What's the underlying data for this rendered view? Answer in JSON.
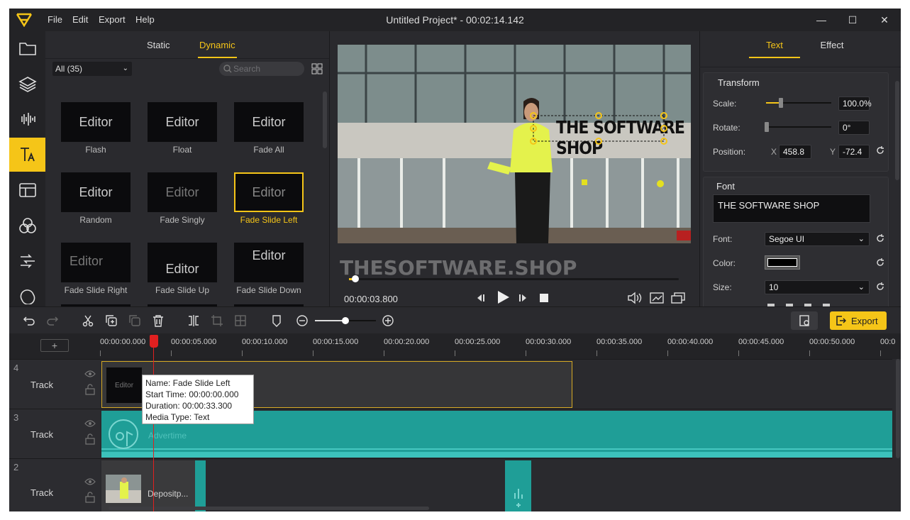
{
  "app": {
    "title": "Untitled Project* - 00:02:14.142"
  },
  "menu": {
    "file": "File",
    "edit": "Edit",
    "export": "Export",
    "help": "Help"
  },
  "library": {
    "tabs": {
      "static": "Static",
      "dynamic": "Dynamic"
    },
    "filter": "All (35)",
    "search_placeholder": "Search",
    "items": [
      {
        "thumb": "Editor",
        "label": "Flash"
      },
      {
        "thumb": "Editor",
        "label": "Float"
      },
      {
        "thumb": "Editor",
        "label": "Fade All"
      },
      {
        "thumb": "Editor",
        "label": "Random"
      },
      {
        "thumb": "Editor",
        "label": "Fade Singly"
      },
      {
        "thumb": "Editor",
        "label": "Fade Slide Left"
      },
      {
        "thumb": "Editor",
        "label": "Fade Slide Right"
      },
      {
        "thumb": "Editor",
        "label": "Fade Slide Up"
      },
      {
        "thumb": "Editor",
        "label": "Fade Slide Down"
      }
    ]
  },
  "preview": {
    "overlay_text": "THE SOFTWARE SHOP",
    "watermark": "THESOFTWARE.SHOP",
    "time": "00:00:03.800",
    "progress": 0.02
  },
  "props": {
    "tabs": {
      "text": "Text",
      "effect": "Effect"
    },
    "transform": {
      "title": "Transform",
      "scale_label": "Scale:",
      "scale_value": "100.0%",
      "rotate_label": "Rotate:",
      "rotate_value": "0°",
      "position_label": "Position:",
      "x_label": "X",
      "x_value": "458.8",
      "y_label": "Y",
      "y_value": "-72.4"
    },
    "font": {
      "title": "Font",
      "text_value": "THE SOFTWARE SHOP",
      "font_label": "Font:",
      "font_value": "Segoe UI",
      "color_label": "Color:",
      "color_value": "#000000",
      "size_label": "Size:",
      "size_value": "10"
    }
  },
  "toolbar": {
    "export_label": "Export"
  },
  "timeline": {
    "ticks": [
      "00:00:00.000",
      "00:00:05.000",
      "00:00:10.000",
      "00:00:15.000",
      "00:00:20.000",
      "00:00:25.000",
      "00:00:30.000",
      "00:00:35.000",
      "00:00:40.000",
      "00:00:45.000",
      "00:00:50.000",
      "00:0"
    ],
    "tracks": [
      {
        "num": "4",
        "name": "Track"
      },
      {
        "num": "3",
        "name": "Track"
      },
      {
        "num": "2",
        "name": "Track"
      }
    ],
    "clips": {
      "text_thumb": "Editor",
      "audio": "Advertime",
      "video": "Depositp..."
    },
    "tooltip": {
      "name": "Name: Fade Slide Left",
      "start": "Start Time: 00:00:00.000",
      "duration": "Duration: 00:00:33.300",
      "type": "Media Type: Text"
    }
  },
  "colors": {
    "accent": "#f5c518",
    "audio": "#1f9e97",
    "bg": "#2a2a2e"
  }
}
